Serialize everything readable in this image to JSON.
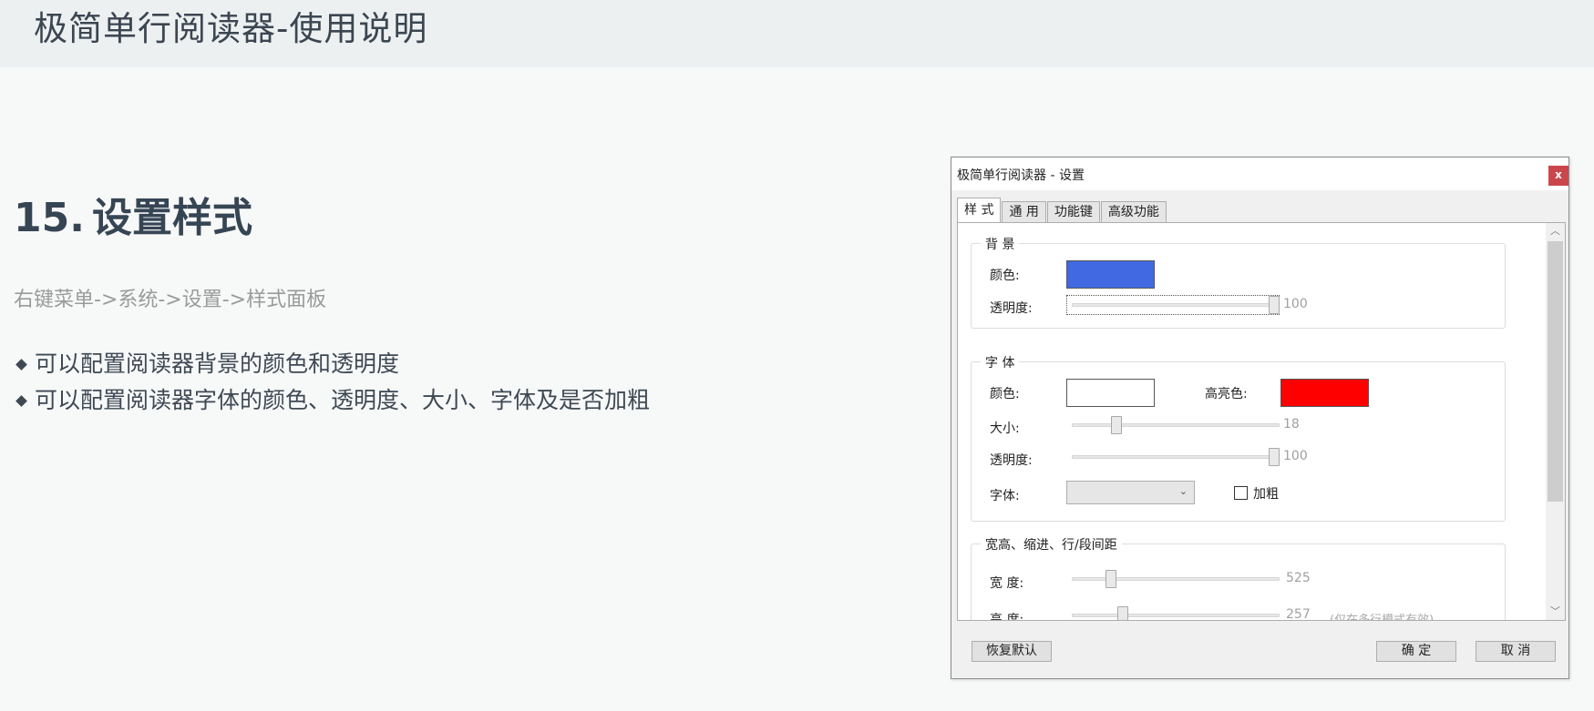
{
  "header": {
    "title": "极简单行阅读器-使用说明"
  },
  "section": {
    "number": "15.",
    "title": "设置样式",
    "subtitle": "右键菜单->系统->设置->样式面板",
    "bullets": [
      "可以配置阅读器背景的颜色和透明度",
      "可以配置阅读器字体的颜色、透明度、大小、字体及是否加粗"
    ]
  },
  "dialog": {
    "title": "极简单行阅读器 - 设置",
    "close_label": "x",
    "tabs": [
      {
        "label": "样 式",
        "active": true
      },
      {
        "label": "通 用",
        "active": false
      },
      {
        "label": "功能键",
        "active": false
      },
      {
        "label": "高级功能",
        "active": false
      }
    ],
    "background": {
      "group_label": "背 景",
      "color_label": "颜色:",
      "color": "#4169e1",
      "opacity_label": "透明度:",
      "opacity_value": "100",
      "opacity_fraction": 1.0
    },
    "font": {
      "group_label": "字 体",
      "color_label": "颜色:",
      "color": "#ffffff",
      "highlight_label": "高亮色:",
      "highlight_color": "#ff0000",
      "size_label": "大小:",
      "size_value": "18",
      "size_fraction": 0.2,
      "opacity_label": "透明度:",
      "opacity_value": "100",
      "opacity_fraction": 1.0,
      "family_label": "字体:",
      "family_value": "",
      "bold_label": "加粗",
      "bold_checked": false
    },
    "dimensions": {
      "group_label": "宽高、缩进、行/段间距",
      "width_label": "宽 度:",
      "width_value": "525",
      "width_fraction": 0.17,
      "height_label": "高 度:",
      "height_value": "257",
      "height_fraction": 0.23,
      "height_note": "(仅在多行模式有效)"
    },
    "buttons": {
      "reset": "恢复默认",
      "ok": "确 定",
      "cancel": "取 消"
    },
    "scroll": {
      "up": "︿",
      "down": "﹀"
    }
  }
}
